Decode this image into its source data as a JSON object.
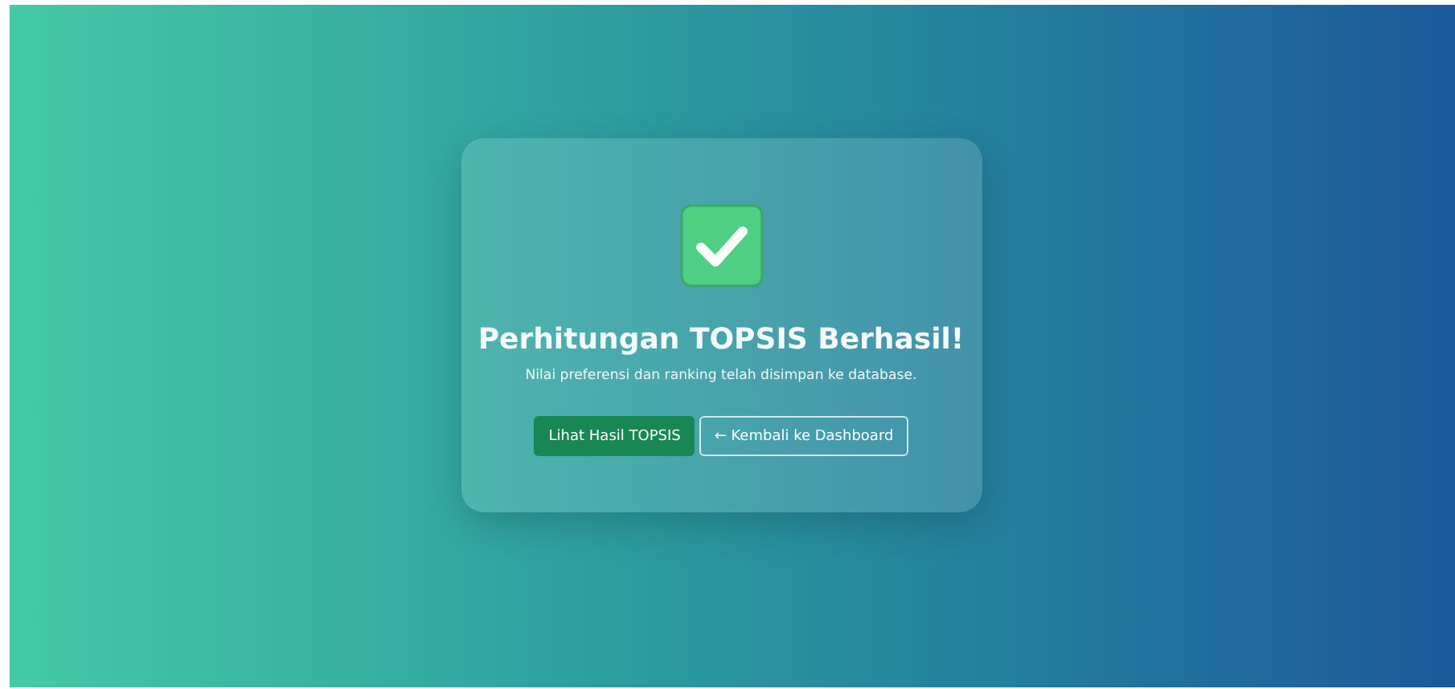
{
  "card": {
    "title": "Perhitungan TOPSIS Berhasil!",
    "message": "Nilai preferensi dan ranking telah disimpan ke database.",
    "buttons": [
      {
        "label": "Lihat Hasil TOPSIS",
        "kind": "solid"
      },
      {
        "label": "← Kembali ke Dashboard",
        "kind": "outline"
      }
    ]
  }
}
